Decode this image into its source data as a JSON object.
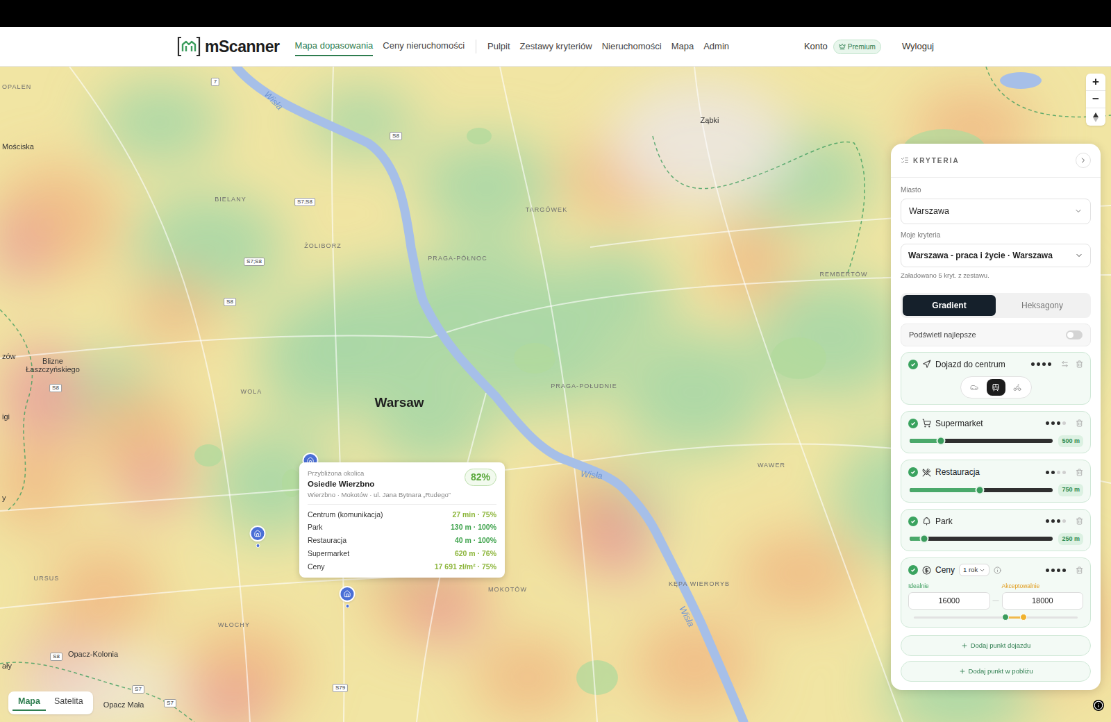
{
  "header": {
    "logo": "mScanner",
    "nav_primary": [
      {
        "label": "Mapa dopasowania",
        "selected": true
      },
      {
        "label": "Ceny nieruchomości",
        "selected": false
      }
    ],
    "nav_secondary": [
      {
        "label": "Pulpit",
        "selected": false
      },
      {
        "label": "Zestawy kryteriów",
        "selected": false
      },
      {
        "label": "Nieruchomości",
        "selected": false
      },
      {
        "label": "Mapa",
        "selected": false
      },
      {
        "label": "Admin",
        "selected": false
      }
    ],
    "account": "Konto",
    "badge": "Premium",
    "logout": "Wyloguj"
  },
  "map": {
    "labels": [
      {
        "text": "OPALEN",
        "kind": "district"
      },
      {
        "text": "Mościska",
        "kind": "town"
      },
      {
        "text": "7",
        "kind": "road"
      },
      {
        "text": "S8",
        "kind": "road"
      },
      {
        "text": "Wisła",
        "kind": "river"
      },
      {
        "text": "BIELANY",
        "kind": "district"
      },
      {
        "text": "S7;S8",
        "kind": "road"
      },
      {
        "text": "TARGÓWEK",
        "kind": "district"
      },
      {
        "text": "Ząbki",
        "kind": "town"
      },
      {
        "text": "ŻOLIBORZ",
        "kind": "district"
      },
      {
        "text": "S7;S8",
        "kind": "road"
      },
      {
        "text": "PRAGA-PÓŁNOC",
        "kind": "district"
      },
      {
        "text": "REMBERTÓW",
        "kind": "district"
      },
      {
        "text": "S8",
        "kind": "road"
      },
      {
        "text": "zów",
        "kind": "town"
      },
      {
        "text": "Blizne Łaszczyńskiego",
        "kind": "town"
      },
      {
        "text": "S8",
        "kind": "road"
      },
      {
        "text": "igi",
        "kind": "town"
      },
      {
        "text": "WOLA",
        "kind": "district"
      },
      {
        "text": "Warsaw",
        "kind": "city"
      },
      {
        "text": "PRAGA-POŁUDNIE",
        "kind": "district"
      },
      {
        "text": "WAWER",
        "kind": "district"
      },
      {
        "text": "Wisła",
        "kind": "river"
      },
      {
        "text": "y",
        "kind": "town"
      },
      {
        "text": "URSUS",
        "kind": "district"
      },
      {
        "text": "MOKOTÓW",
        "kind": "district"
      },
      {
        "text": "KĘPA WIERORYB",
        "kind": "district"
      },
      {
        "text": "Wisła",
        "kind": "river"
      },
      {
        "text": "WŁOCHY",
        "kind": "district"
      },
      {
        "text": "ały",
        "kind": "town"
      },
      {
        "text": "Opacz-Kolonia",
        "kind": "town"
      },
      {
        "text": "S8",
        "kind": "road"
      },
      {
        "text": "S7",
        "kind": "road"
      },
      {
        "text": "Opacz Mała",
        "kind": "town"
      },
      {
        "text": "S7",
        "kind": "road"
      },
      {
        "text": "S79",
        "kind": "road"
      }
    ],
    "zoom_in": "+",
    "zoom_out": "−",
    "map_types": [
      {
        "label": "Mapa",
        "selected": true
      },
      {
        "label": "Satelita",
        "selected": false
      }
    ]
  },
  "tooltip": {
    "caption": "Przybliżona okolica",
    "title": "Osiedle Wierzbno",
    "address": "Wierzbno · Mokotów · ul. Jana Bytnara „Rudego”",
    "score": "82%",
    "rows": [
      {
        "label": "Centrum (komunikacja)",
        "value": "27 min · 75%",
        "color": "#8db63c"
      },
      {
        "label": "Park",
        "value": "130 m · 100%",
        "color": "#3fa34d"
      },
      {
        "label": "Restauracja",
        "value": "40 m · 100%",
        "color": "#3fa34d"
      },
      {
        "label": "Supermarket",
        "value": "620 m · 76%",
        "color": "#8db63c"
      },
      {
        "label": "Ceny",
        "value": "17 691 zł/m² · 75%",
        "color": "#8db63c"
      }
    ]
  },
  "panel": {
    "title": "KRYTERIA",
    "city_label": "Miasto",
    "city": "Warszawa",
    "set_label": "Moje kryteria",
    "set": "Warszawa - praca i życie · Warszawa",
    "note": "Załadowano 5 kryt. z zestawu.",
    "view_modes": [
      {
        "label": "Gradient",
        "selected": true
      },
      {
        "label": "Heksagony",
        "selected": false
      }
    ],
    "highlight": {
      "label": "Podświetl najlepsze",
      "on": false
    },
    "criteria": [
      {
        "kind": "commute",
        "enabled": true,
        "title": "Dojazd do centrum",
        "importance": 4,
        "modes": [
          {
            "selected": false
          },
          {
            "selected": true
          },
          {
            "selected": false
          }
        ]
      },
      {
        "kind": "distance",
        "enabled": true,
        "title": "Supermarket",
        "importance": 3,
        "level": 0.22,
        "value": "500 m"
      },
      {
        "kind": "distance",
        "enabled": true,
        "title": "Restauracja",
        "importance": 2,
        "level": 0.49,
        "value": "750 m"
      },
      {
        "kind": "distance",
        "enabled": true,
        "title": "Park",
        "importance": 3,
        "level": 0.1,
        "value": "250 m"
      },
      {
        "kind": "price",
        "enabled": true,
        "title": "Ceny",
        "importance": 4,
        "period": "1 rok",
        "ideal_label": "Idealnie",
        "ideal": "16000",
        "acceptable_label": "Akceptowalnie",
        "acceptable": "18000",
        "separator": "—",
        "ideal_level": 0.56,
        "acceptable_level": 0.67
      }
    ],
    "buttons": [
      {
        "label": "Dodaj punkt dojazdu"
      },
      {
        "label": "Dodaj punkt w pobliżu"
      }
    ]
  }
}
